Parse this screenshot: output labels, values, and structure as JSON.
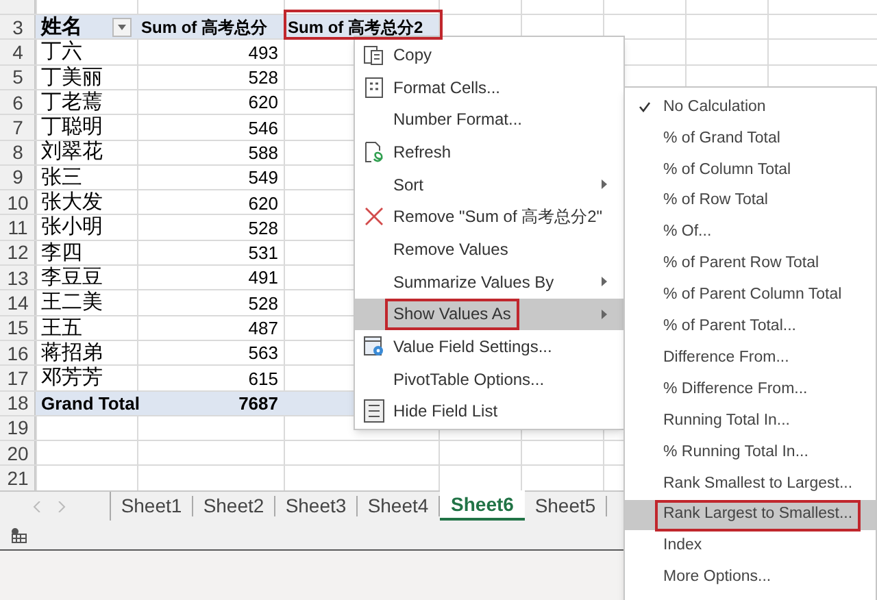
{
  "sheet": {
    "columns": [
      {
        "label": "姓名",
        "outlined": false
      },
      {
        "label": "Sum of 高考总分",
        "outlined": false
      },
      {
        "label": "Sum of 高考总分2",
        "outlined": true
      }
    ],
    "header_row": {
      "row": "3"
    },
    "rows": [
      {
        "row": "4",
        "name": "丁六",
        "value": "493"
      },
      {
        "row": "5",
        "name": "丁美丽",
        "value": "528"
      },
      {
        "row": "6",
        "name": "丁老蔫",
        "value": "620"
      },
      {
        "row": "7",
        "name": "丁聪明",
        "value": "546"
      },
      {
        "row": "8",
        "name": "刘翠花",
        "value": "588"
      },
      {
        "row": "9",
        "name": "张三",
        "value": "549"
      },
      {
        "row": "10",
        "name": "张大发",
        "value": "620"
      },
      {
        "row": "11",
        "name": "张小明",
        "value": "528"
      },
      {
        "row": "12",
        "name": "李四",
        "value": "531"
      },
      {
        "row": "13",
        "name": "李豆豆",
        "value": "491"
      },
      {
        "row": "14",
        "name": "王二美",
        "value": "528"
      },
      {
        "row": "15",
        "name": "王五",
        "value": "487"
      },
      {
        "row": "16",
        "name": "蒋招弟",
        "value": "563"
      },
      {
        "row": "17",
        "name": "邓芳芳",
        "value": "615"
      }
    ],
    "total_row": {
      "row": "18",
      "name": "Grand Total",
      "value": "7687"
    },
    "empty_rows": [
      "19",
      "20",
      "21"
    ]
  },
  "context_menu": [
    {
      "label": "Copy",
      "kind": "copy",
      "submenu": false,
      "selected": false,
      "outlined": false
    },
    {
      "label": "Format Cells...",
      "kind": "format",
      "submenu": false,
      "selected": false,
      "outlined": false
    },
    {
      "label": "Number Format...",
      "kind": "plain",
      "submenu": false,
      "selected": false,
      "outlined": false
    },
    {
      "label": "Refresh",
      "kind": "refresh",
      "submenu": false,
      "selected": false,
      "outlined": false
    },
    {
      "label": "Sort",
      "kind": "plain",
      "submenu": true,
      "selected": false,
      "outlined": false
    },
    {
      "label": "Remove \"Sum of 高考总分2\"",
      "kind": "remove",
      "submenu": false,
      "selected": false,
      "outlined": false
    },
    {
      "label": "Remove Values",
      "kind": "plain",
      "submenu": false,
      "selected": false,
      "outlined": false
    },
    {
      "label": "Summarize Values By",
      "kind": "plain",
      "submenu": true,
      "selected": false,
      "outlined": false
    },
    {
      "label": "Show Values As",
      "kind": "plain",
      "submenu": true,
      "selected": true,
      "outlined": true
    },
    {
      "label": "Value Field Settings...",
      "kind": "settings",
      "submenu": false,
      "selected": false,
      "outlined": false
    },
    {
      "label": "PivotTable Options...",
      "kind": "plain",
      "submenu": false,
      "selected": false,
      "outlined": false
    },
    {
      "label": "Hide Field List",
      "kind": "fieldlist",
      "submenu": false,
      "selected": false,
      "outlined": false
    }
  ],
  "submenu": [
    {
      "label": "No Calculation",
      "checked": true,
      "selected": false,
      "outlined": false
    },
    {
      "label": "% of Grand Total",
      "checked": false,
      "selected": false,
      "outlined": false
    },
    {
      "label": "% of Column Total",
      "checked": false,
      "selected": false,
      "outlined": false
    },
    {
      "label": "% of Row Total",
      "checked": false,
      "selected": false,
      "outlined": false
    },
    {
      "label": "% Of...",
      "checked": false,
      "selected": false,
      "outlined": false
    },
    {
      "label": "% of Parent Row Total",
      "checked": false,
      "selected": false,
      "outlined": false
    },
    {
      "label": "% of Parent Column Total",
      "checked": false,
      "selected": false,
      "outlined": false
    },
    {
      "label": "% of Parent Total...",
      "checked": false,
      "selected": false,
      "outlined": false
    },
    {
      "label": "Difference From...",
      "checked": false,
      "selected": false,
      "outlined": false
    },
    {
      "label": "% Difference From...",
      "checked": false,
      "selected": false,
      "outlined": false
    },
    {
      "label": "Running Total In...",
      "checked": false,
      "selected": false,
      "outlined": false
    },
    {
      "label": "% Running Total In...",
      "checked": false,
      "selected": false,
      "outlined": false
    },
    {
      "label": "Rank Smallest to Largest...",
      "checked": false,
      "selected": false,
      "outlined": false
    },
    {
      "label": "Rank Largest to Smallest...",
      "checked": false,
      "selected": true,
      "outlined": true
    },
    {
      "label": "Index",
      "checked": false,
      "selected": false,
      "outlined": false
    },
    {
      "label": "More Options...",
      "checked": false,
      "selected": false,
      "outlined": false
    }
  ],
  "sheet_tabs": [
    {
      "label": "Sheet1",
      "selected": false
    },
    {
      "label": "Sheet2",
      "selected": false
    },
    {
      "label": "Sheet3",
      "selected": false
    },
    {
      "label": "Sheet4",
      "selected": false
    },
    {
      "label": "Sheet6",
      "selected": true
    },
    {
      "label": "Sheet5",
      "selected": false
    }
  ]
}
